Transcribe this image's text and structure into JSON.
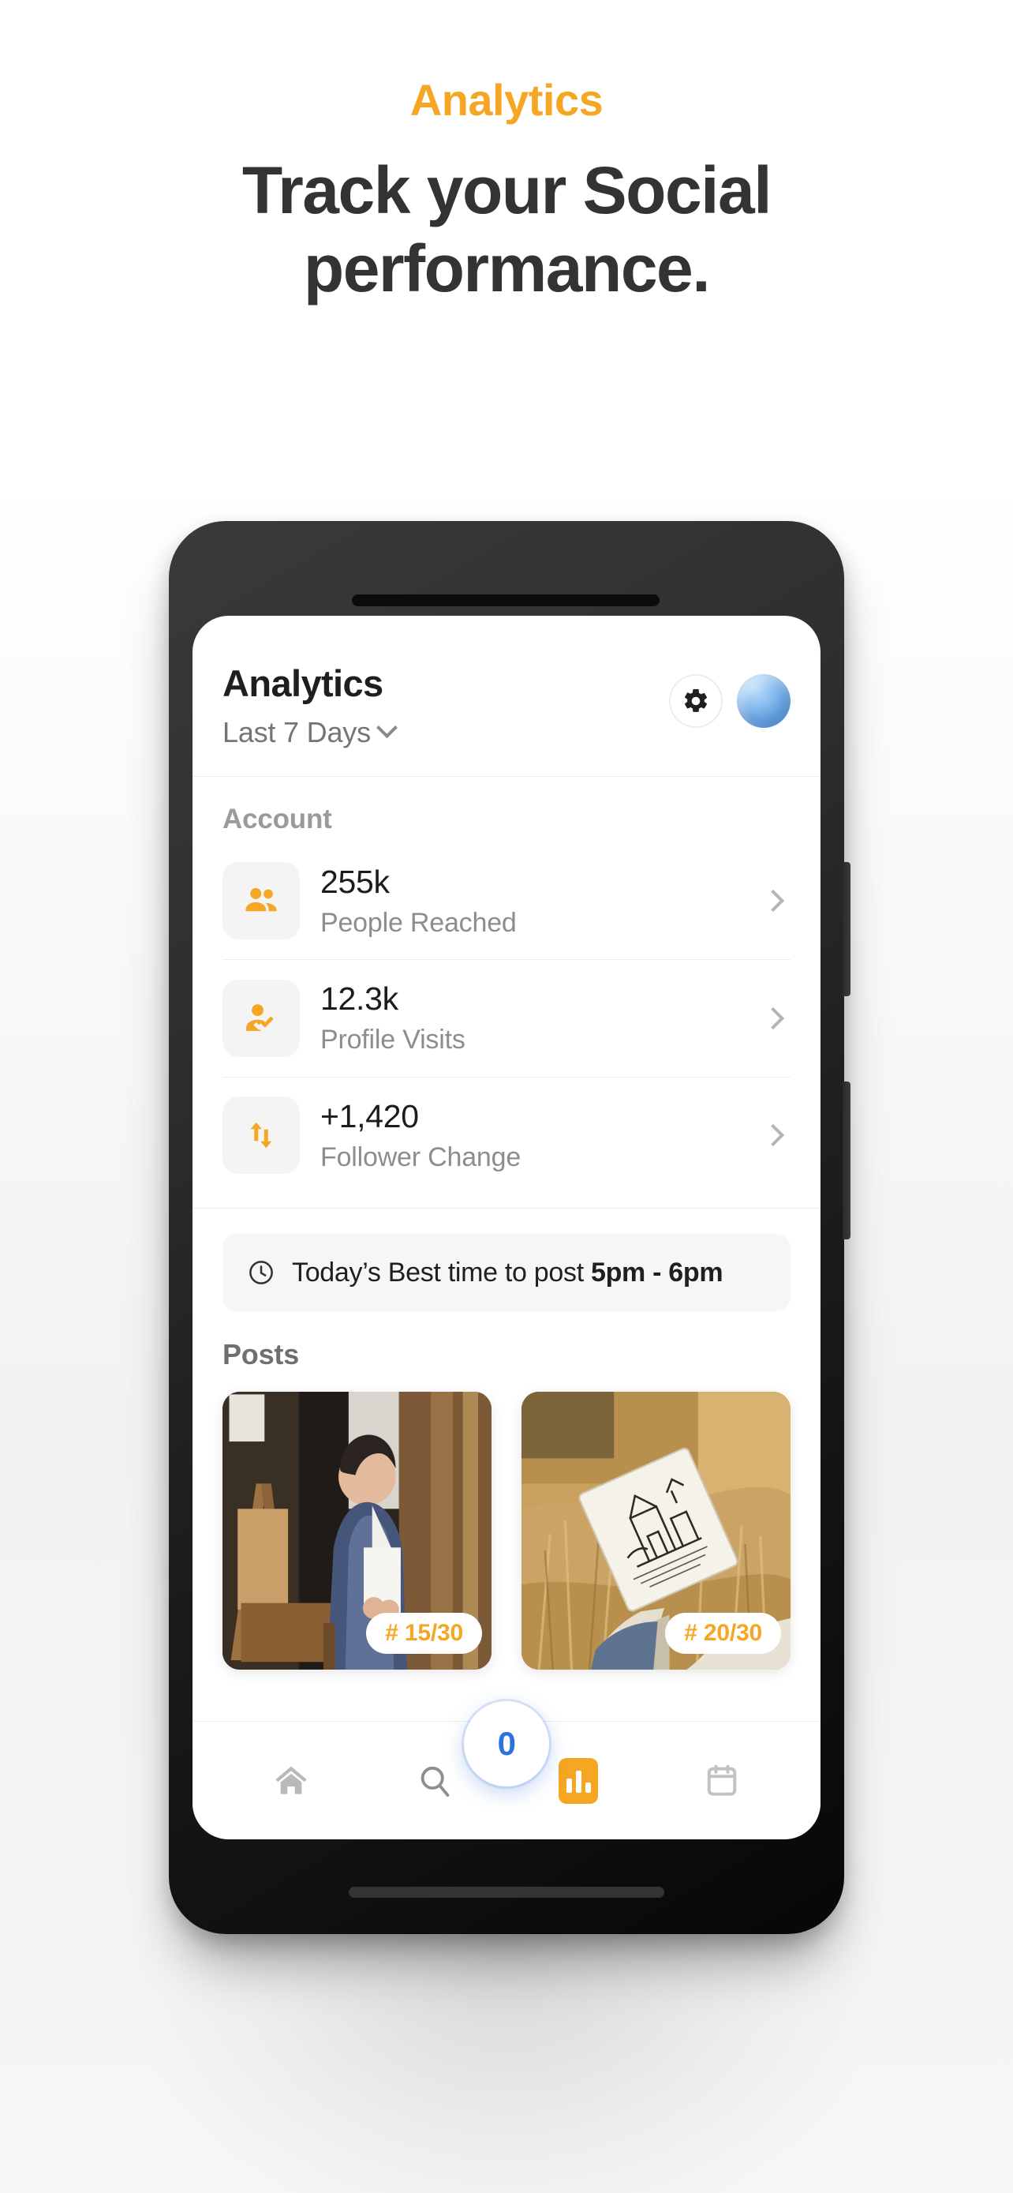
{
  "promo": {
    "eyebrow": "Analytics",
    "title": "Track your Social performance."
  },
  "colors": {
    "accent_orange": "#F5A623",
    "headline_dark": "#333333",
    "fab_blue": "#2B72E0",
    "muted_gray": "#8D8D8D"
  },
  "app": {
    "header": {
      "title": "Analytics",
      "range_label": "Last 7 Days",
      "range_chevron": "chevron-down-icon",
      "settings_icon": "gear-icon",
      "avatar": "avatar"
    },
    "account": {
      "section_label": "Account",
      "metrics": [
        {
          "icon": "people-icon",
          "value": "255k",
          "label": "People Reached",
          "chevron": "chevron-right-icon"
        },
        {
          "icon": "person-check-icon",
          "value": "12.3k",
          "label": "Profile Visits",
          "chevron": "chevron-right-icon"
        },
        {
          "icon": "arrows-up-down-icon",
          "value": "+1,420",
          "label": "Follower Change",
          "chevron": "chevron-right-icon"
        }
      ]
    },
    "best_time": {
      "icon": "clock-icon",
      "prefix": "Today’s Best time to post ",
      "time": "5pm - 6pm"
    },
    "posts": {
      "section_label": "Posts",
      "items": [
        {
          "badge": "# 15/30",
          "alt": "woman-standing-by-easels-in-art-studio"
        },
        {
          "badge": "# 20/30",
          "alt": "hand-holding-sketchbook-in-dry-grass"
        }
      ]
    },
    "bottom_nav": {
      "items": [
        {
          "icon": "home-icon",
          "active": false
        },
        {
          "icon": "search-icon",
          "active": false
        },
        {
          "icon": "chart-bar-icon",
          "active": true
        },
        {
          "icon": "calendar-icon",
          "active": false
        }
      ],
      "fab_label": "0"
    }
  }
}
